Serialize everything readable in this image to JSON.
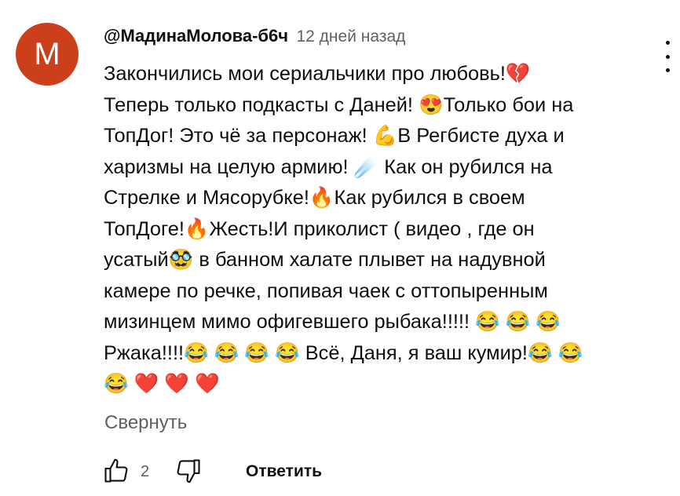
{
  "comment": {
    "avatar_letter": "M",
    "author": "@МадинаМолова-б6ч",
    "time": "12 дней назад",
    "lines": [
      "Закончились мои сериальчики про любовь!💔",
      "Теперь только подкасты с Даней! 😍Только бои на",
      "ТопДог! Это чё за персонаж! 💪В Регбисте духа и",
      "харизмы на целую армию! ☄️ Как он рубился на",
      "Стрелке и Мясорубке!🔥Как рубился в своем",
      "ТопДоге!🔥Жесть!И приколист ( видео , где он",
      "усатый🥸 в банном халате плывет на надувной",
      "камере по речке, попивая чаек с оттопыренным",
      "мизинцем мимо офигевшего рыбака!!!!! 😂 😂 😂",
      "Ржака!!!!😂 😂 😂 😂 Всё, Даня, я ваш кумир!😂 😂",
      "😂 ❤️ ❤️ ❤️"
    ],
    "collapse_label": "Свернуть",
    "like_count": "2",
    "reply_label": "Ответить"
  },
  "icons": {
    "menu": "more-vert-icon",
    "like": "thumb-up-icon",
    "dislike": "thumb-down-icon"
  },
  "colors": {
    "avatar_bg": "#cc3f1b",
    "secondary_text": "#606060",
    "primary_text": "#0f0f0f"
  }
}
